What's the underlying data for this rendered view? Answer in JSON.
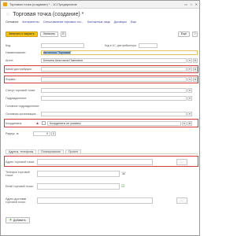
{
  "window": {
    "title": "Торговая точка (создание) * - 1С:Предприятие",
    "buttons": [
      "▭",
      "☆",
      "✕"
    ]
  },
  "header": {
    "star": "☆",
    "title": "Торговая точка (создание) *"
  },
  "nav": {
    "items": [
      "Основное",
      "Контрагенты",
      "Сопоставление торговых точ...",
      "Контактные лица",
      "Договоры",
      "Еще"
    ]
  },
  "toolbar": {
    "save_close": "Записать и закрыть",
    "save": "Записать",
    "more": "Еще",
    "help": "?"
  },
  "fields": {
    "code_label": "Код:",
    "code_value": "",
    "code_hint": "Код в 1С: дистрибьютора",
    "name_label": "Наименование:",
    "name_value": "Автоточка \"Торговая\"",
    "agent_label": "Агент:",
    "agent_value": "Белкина Анастасия Павловна",
    "channel_label": "Канал дистрибуции:",
    "channel_value": "",
    "format_label": "Формат:",
    "format_value": "",
    "status_label": "Статус торговой точки:",
    "status_value": "",
    "subdivision_label": "Подразделение:",
    "subdivision_value": "",
    "legal_label": "Головное подразделение:",
    "legal_value": "",
    "main_org_label": "Основная организация:",
    "main_org_value": "",
    "coords_label": "Координаты:",
    "coords_value": "Координаты не указаны",
    "radius_label": "Радиус, м:",
    "radius_value": "0"
  },
  "tabs": {
    "items": [
      "Адреса, телефоны",
      "Планирование",
      "Прочее"
    ]
  },
  "address": {
    "outlet_address_label": "Адрес торговой точки:",
    "outlet_address_value": "",
    "phone_label": "Телефон торговой точки:",
    "phone_value": "",
    "email_label": "Email торговой точки:",
    "email_value": "",
    "delivery_label": "Адрес доставки торговой точки:",
    "delivery_value": "",
    "add_label": "Добавить"
  },
  "colors": {
    "primary": "#f0c01b",
    "highlight": "#d43a3a"
  }
}
